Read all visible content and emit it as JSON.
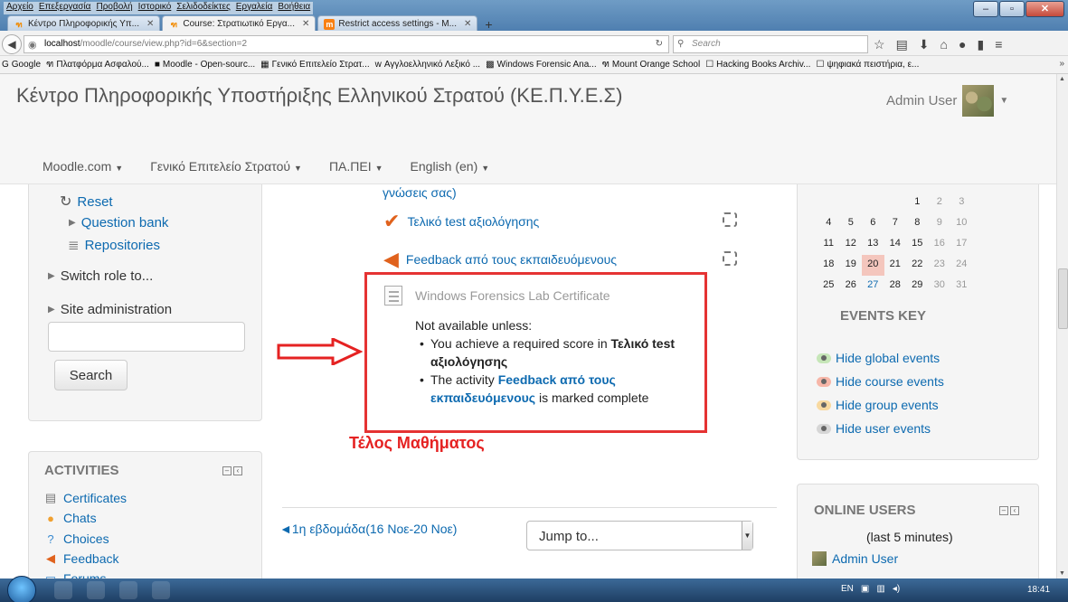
{
  "browser": {
    "menu": [
      "Αρχείο",
      "Επεξεργασία",
      "Προβολή",
      "Ιστορικό",
      "Σελιδοδείκτες",
      "Εργαλεία",
      "Βοήθεια"
    ],
    "tabs": [
      {
        "title": "Κέντρο Πληροφορικής Υπ...",
        "active": false
      },
      {
        "title": "Course: Στρατιωτικό Εργα...",
        "active": true
      },
      {
        "title": "Restrict access settings - M...",
        "active": false
      }
    ],
    "url_host": "localhost",
    "url_path": "/moodle/course/view.php?id=6&section=2",
    "search_placeholder": "Search",
    "bookmarks": [
      "Google",
      "Πλατφόρμα Ασφαλού...",
      "Moodle - Open-sourc...",
      "Γενικό Επιτελείο Στρατ...",
      "Αγγλοελληνικό Λεξικό ...",
      "Windows Forensic Ana...",
      "Mount Orange School",
      "Hacking Books Archiv...",
      "ψηφιακά πειστήρια, ε..."
    ]
  },
  "header": {
    "site_title": "Κέντρο Πληροφορικής Υποστήριξης Ελληνικού Στρατού (ΚΕ.Π.Υ.Ε.Σ)",
    "user_name": "Admin User",
    "nav": [
      "Moodle.com",
      "Γενικό Επιτελείο Στρατού",
      "ΠΑ.ΠΕΙ",
      "English (en)"
    ]
  },
  "admin_block": {
    "reset": "Reset",
    "question_bank": "Question bank",
    "repositories": "Repositories",
    "switch_role": "Switch role to...",
    "site_admin": "Site administration",
    "search_button": "Search"
  },
  "activities_block": {
    "title": "ACTIVITIES",
    "items": [
      "Certificates",
      "Chats",
      "Choices",
      "Feedback",
      "Forums"
    ]
  },
  "course": {
    "tail_text": "γνώσεις σας)",
    "quiz_name": "Τελικό test αξιολόγησης",
    "feedback_name": "Feedback από τους εκπαιδευόμενους",
    "cert_name": "Windows Forensics Lab Certificate",
    "restrict_intro": "Not available unless:",
    "cond1_prefix": "You achieve a required score in",
    "cond1_bold": "Τελικό test αξιολόγησης",
    "cond2_prefix": "The activity",
    "cond2_link": "Feedback από τους εκπαιδευόμενους",
    "cond2_suffix": "is marked complete",
    "annotation": "Τέλος Μαθήματος",
    "prev_section": "◄1η εβδομάδα(16 Νοε-20 Νοε)",
    "jump_to": "Jump to..."
  },
  "calendar": {
    "rows": [
      [
        "",
        "",
        "",
        "",
        "1",
        "2",
        "3"
      ],
      [
        "4",
        "5",
        "6",
        "7",
        "8",
        "9",
        "10"
      ],
      [
        "11",
        "12",
        "13",
        "14",
        "15",
        "16",
        "17"
      ],
      [
        "18",
        "19",
        "20",
        "21",
        "22",
        "23",
        "24"
      ],
      [
        "25",
        "26",
        "27",
        "28",
        "29",
        "30",
        "31"
      ]
    ],
    "today": "20",
    "linked": "27",
    "events_key_title": "EVENTS KEY",
    "events": [
      {
        "label": "Hide global events",
        "color": "#c6e6b8"
      },
      {
        "label": "Hide course events",
        "color": "#f7b6a8"
      },
      {
        "label": "Hide group events",
        "color": "#f8d9a0"
      },
      {
        "label": "Hide user events",
        "color": "#d6d6d6"
      }
    ]
  },
  "online_users": {
    "title": "ONLINE USERS",
    "subtitle": "(last 5 minutes)",
    "user": "Admin User"
  },
  "taskbar": {
    "lang": "EN",
    "clock": "18:41"
  },
  "colors": {
    "link": "#0d6ab0",
    "annotation_red": "#e52222"
  }
}
